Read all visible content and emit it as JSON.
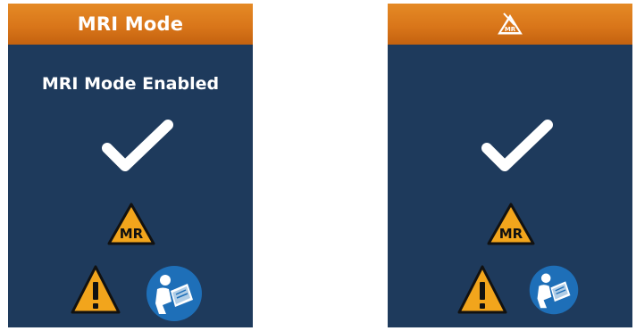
{
  "screens": [
    {
      "header_title": "MRI Mode",
      "subtitle": "MRI Mode Enabled",
      "icons": [
        "checkmark-icon",
        "mr-conditional-icon",
        "caution-icon",
        "consult-manual-icon"
      ]
    },
    {
      "header_icon": "mr-mode-header-icon",
      "icons": [
        "checkmark-icon",
        "mr-conditional-icon",
        "caution-icon",
        "consult-manual-icon"
      ]
    }
  ],
  "mr_label": "MR",
  "colors": {
    "screen_background": "#1e3a5c",
    "header_orange": "#d9761a",
    "warning_yellow": "#f2a51c",
    "manual_blue": "#1e6fb8"
  }
}
